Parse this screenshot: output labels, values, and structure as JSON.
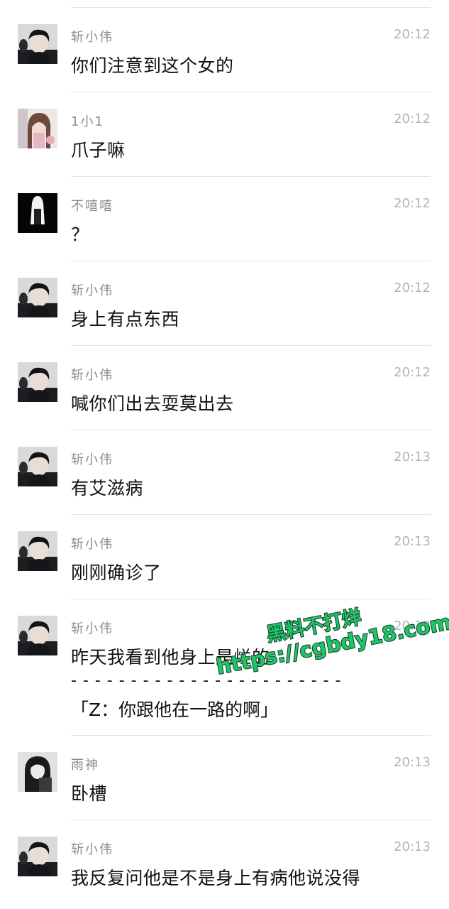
{
  "messages": [
    {
      "sender": "斩小伟",
      "time": "20:12",
      "text": "你们注意到这个女的",
      "avatar": "avatar-dark-hair-man"
    },
    {
      "sender": "1小1",
      "time": "20:12",
      "text": "爪子嘛",
      "avatar": "avatar-girl-pink"
    },
    {
      "sender": "不嘻嘻",
      "time": "20:12",
      "text": "？",
      "avatar": "avatar-black-figure"
    },
    {
      "sender": "斩小伟",
      "time": "20:12",
      "text": "身上有点东西",
      "avatar": "avatar-dark-hair-man"
    },
    {
      "sender": "斩小伟",
      "time": "20:12",
      "text": "喊你们出去耍莫出去",
      "avatar": "avatar-dark-hair-man"
    },
    {
      "sender": "斩小伟",
      "time": "20:13",
      "text": "有艾滋病",
      "avatar": "avatar-dark-hair-man"
    },
    {
      "sender": "斩小伟",
      "time": "20:13",
      "text": "刚刚确诊了",
      "avatar": "avatar-dark-hair-man"
    },
    {
      "sender": "斩小伟",
      "time": "20:13",
      "text": "昨天我看到他身上是烂的",
      "divider": "- - - - - - - - - - - - - - - - - - - - - - -",
      "quote": "「Z：你跟他在一路的啊」",
      "avatar": "avatar-dark-hair-man"
    },
    {
      "sender": "雨神",
      "time": "20:13",
      "text": "卧槽",
      "avatar": "avatar-girl-dark"
    },
    {
      "sender": "斩小伟",
      "time": "20:13",
      "text": "我反复问他是不是身上有病他说没得",
      "avatar": "avatar-dark-hair-man"
    }
  ],
  "watermark": {
    "line1": "黑料不打烊",
    "line2": "https://cgbdy18.com"
  },
  "colors": {
    "watermark_fill": "#23c36a",
    "watermark_stroke": "#0b3d22",
    "divider": "#e4e4e4"
  }
}
